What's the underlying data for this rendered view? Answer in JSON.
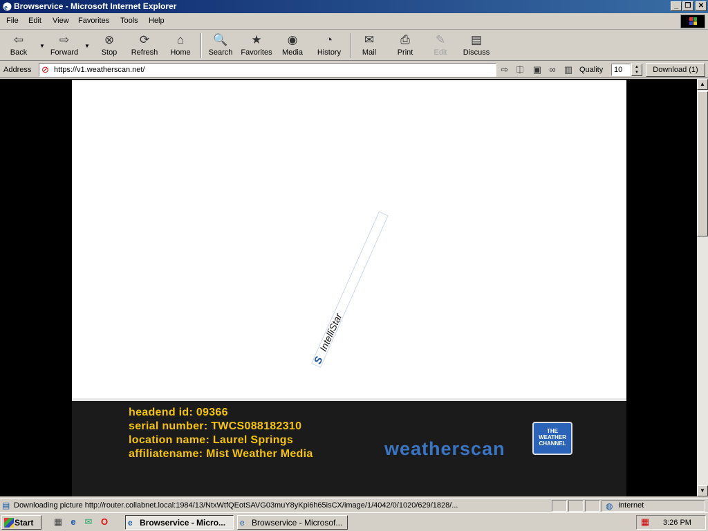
{
  "window": {
    "title": "Browservice - Microsoft Internet Explorer",
    "controls": {
      "minimize": "_",
      "maximize": "❐",
      "close": "✕"
    }
  },
  "menu": [
    "File",
    "Edit",
    "View",
    "Favorites",
    "Tools",
    "Help"
  ],
  "toolbar": {
    "back": "Back",
    "forward": "Forward",
    "stop": "Stop",
    "refresh": "Refresh",
    "home": "Home",
    "search": "Search",
    "favorites": "Favorites",
    "media": "Media",
    "history": "History",
    "mail": "Mail",
    "print": "Print",
    "edit": "Edit",
    "discuss": "Discuss"
  },
  "address": {
    "label": "Address",
    "url": "https://v1.weatherscan.net/"
  },
  "quality": {
    "label": "Quality",
    "value": "10"
  },
  "download": {
    "label": "Download (1)"
  },
  "page": {
    "spinner_text": "IntelliStar",
    "info": {
      "headend": "headend id: 09366",
      "serial": "serial number: TWCS088182310",
      "location": "location name: Laurel Springs",
      "affiliate": "affiliatename: Mist Weather Media"
    },
    "brand": "weatherscan",
    "twc_logo": "THE WEATHER CHANNEL"
  },
  "status": {
    "text": "Downloading picture http://router.collabnet.local:1984/13/NtxWtfQEotSAVG03muY8yKpi6h65isCX/image/1/4042/0/1020/629/1828/...",
    "zone": "Internet"
  },
  "taskbar": {
    "start": "Start",
    "tasks": [
      "Browservice - Micro...",
      "Browservice - Microsof..."
    ],
    "clock": "3:26 PM"
  },
  "colors": {
    "info_text": "#f5c400",
    "brand": "#3a75c4",
    "titlebar": "#0a246a"
  }
}
